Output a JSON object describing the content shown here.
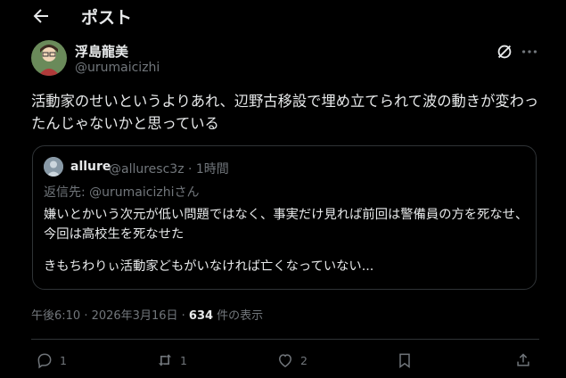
{
  "header": {
    "title": "ポスト",
    "back_icon": "arrow-left-icon"
  },
  "post": {
    "author": {
      "display_name": "浮島龍美",
      "handle": "@urumaicizhi"
    },
    "text": "活動家のせいというよりあれ、辺野古移設で埋め立てられて波の動きが変わったんじゃないかと思っている",
    "timestamp": "午後6:10 · 2026年3月16日",
    "separator": " · ",
    "views_count": "634",
    "views_label": " 件の表示"
  },
  "quote": {
    "name": "allure",
    "meta": "@alluresc3z · 1時間",
    "reply_prefix": "返信先: ",
    "reply_mention": "@urumaicizhi",
    "reply_suffix": "さん",
    "line1": "嫌いとかいう次元が低い問題ではなく、事実だけ見れば前回は警備員の方を死なせ、今回は高校生を死なせた",
    "line2": "きもちわりぃ活動家どもがいなければ亡くなっていない..."
  },
  "actions": {
    "reply_count": "1",
    "repost_count": "1",
    "like_count": "2"
  },
  "colors": {
    "background": "#000000",
    "text": "#e7e9ea",
    "muted": "#71767b",
    "border": "#2f3336"
  }
}
